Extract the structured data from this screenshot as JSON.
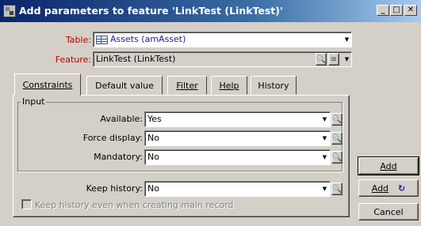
{
  "window": {
    "title": "Add parameters to feature 'LinkTest (LinkTest)'",
    "minimize_glyph": "_",
    "maximize_glyph": "□",
    "close_glyph": "✕"
  },
  "form": {
    "table_label": "Table:",
    "table_value": "Assets (amAsset)",
    "feature_label": "Feature:",
    "feature_value": "LinkTest (LinkTest)"
  },
  "tabs": [
    {
      "label": "Constraints",
      "active": true
    },
    {
      "label": "Default value",
      "active": false
    },
    {
      "label": "Filter",
      "active": false
    },
    {
      "label": "Help",
      "active": false
    },
    {
      "label": "History",
      "active": false
    }
  ],
  "constraints": {
    "group_title": "Input",
    "available_label": "Available:",
    "available_value": "Yes",
    "force_display_label": "Force display:",
    "force_display_value": "No",
    "mandatory_label": "Mandatory:",
    "mandatory_value": "No",
    "keep_history_label": "Keep history:",
    "keep_history_value": "No",
    "keep_history_creation_label": "Keep history even when creating main record"
  },
  "buttons": {
    "add": "Add",
    "add_repeat": "Add",
    "cancel": "Cancel"
  },
  "icons": {
    "dropdown": "▼",
    "zoom": "🔍",
    "list": "≡",
    "repeat": "↻"
  },
  "colors": {
    "title_gradient_start": "#0a246a",
    "title_gradient_end": "#a6caf0",
    "required_label": "#c00000",
    "link_value": "#1a1aa0",
    "window_bg": "#d4d0c8"
  }
}
